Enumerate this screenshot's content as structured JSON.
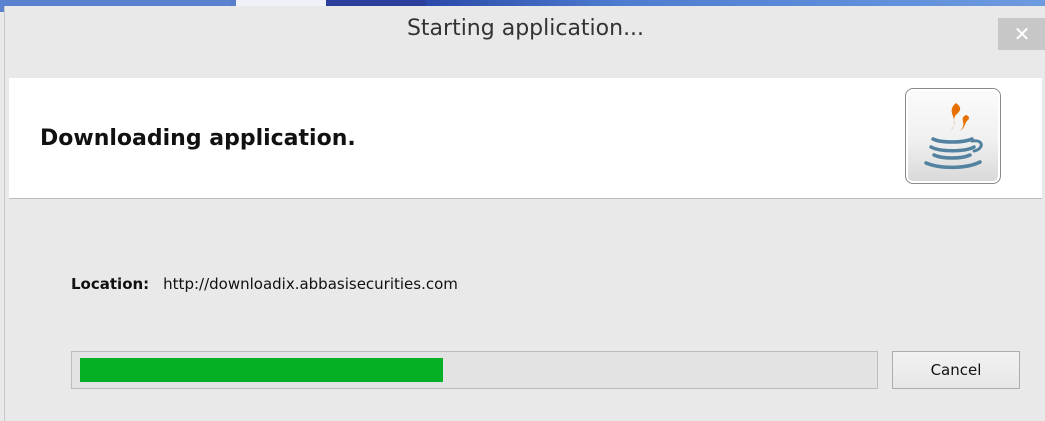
{
  "window": {
    "title": "Starting application...",
    "close_glyph": "✕"
  },
  "header": {
    "title": "Downloading application.",
    "icon": "java-icon"
  },
  "body": {
    "location_label": "Location:",
    "location_value": "http://downloadix.abbasisecurities.com",
    "progress_fraction": 0.46,
    "cancel_label": "Cancel"
  },
  "colors": {
    "progress_fill": "#06b025",
    "title_bar": "#e9e9e9",
    "close_button": "#c7c7c7"
  }
}
